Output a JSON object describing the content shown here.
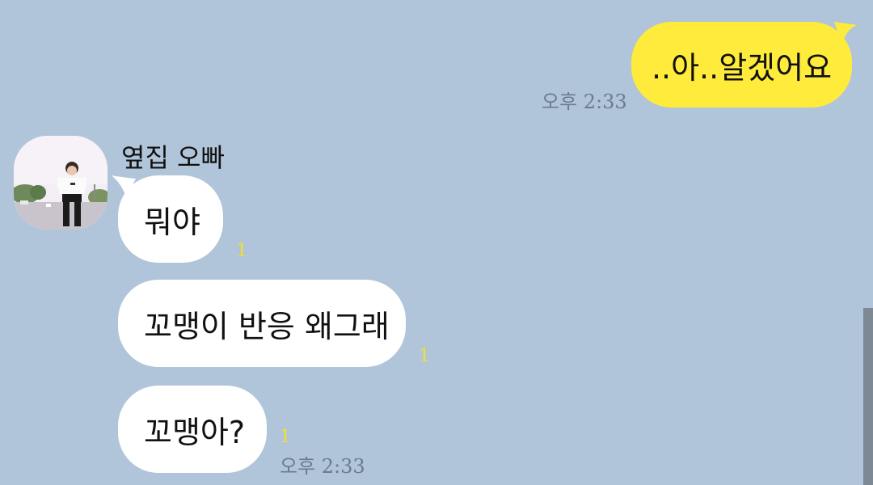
{
  "outgoing": {
    "text": "..아..알겠어요",
    "time": "오후 2:33",
    "bubble_color": "#ffeb3b"
  },
  "incoming": {
    "sender_name": "옆집 오빠",
    "avatar_icon": "profile-photo",
    "messages": [
      {
        "text": "뭐야",
        "unread": "1"
      },
      {
        "text": "꼬맹이 반응 왜그래",
        "unread": "1"
      },
      {
        "text": "꼬맹아?",
        "unread": "1"
      }
    ],
    "time": "오후 2:33",
    "bubble_color": "#ffffff",
    "unread_color": "#f2e02a"
  },
  "theme": {
    "background": "#b1c5da",
    "scrollbar": "#7d8995"
  }
}
